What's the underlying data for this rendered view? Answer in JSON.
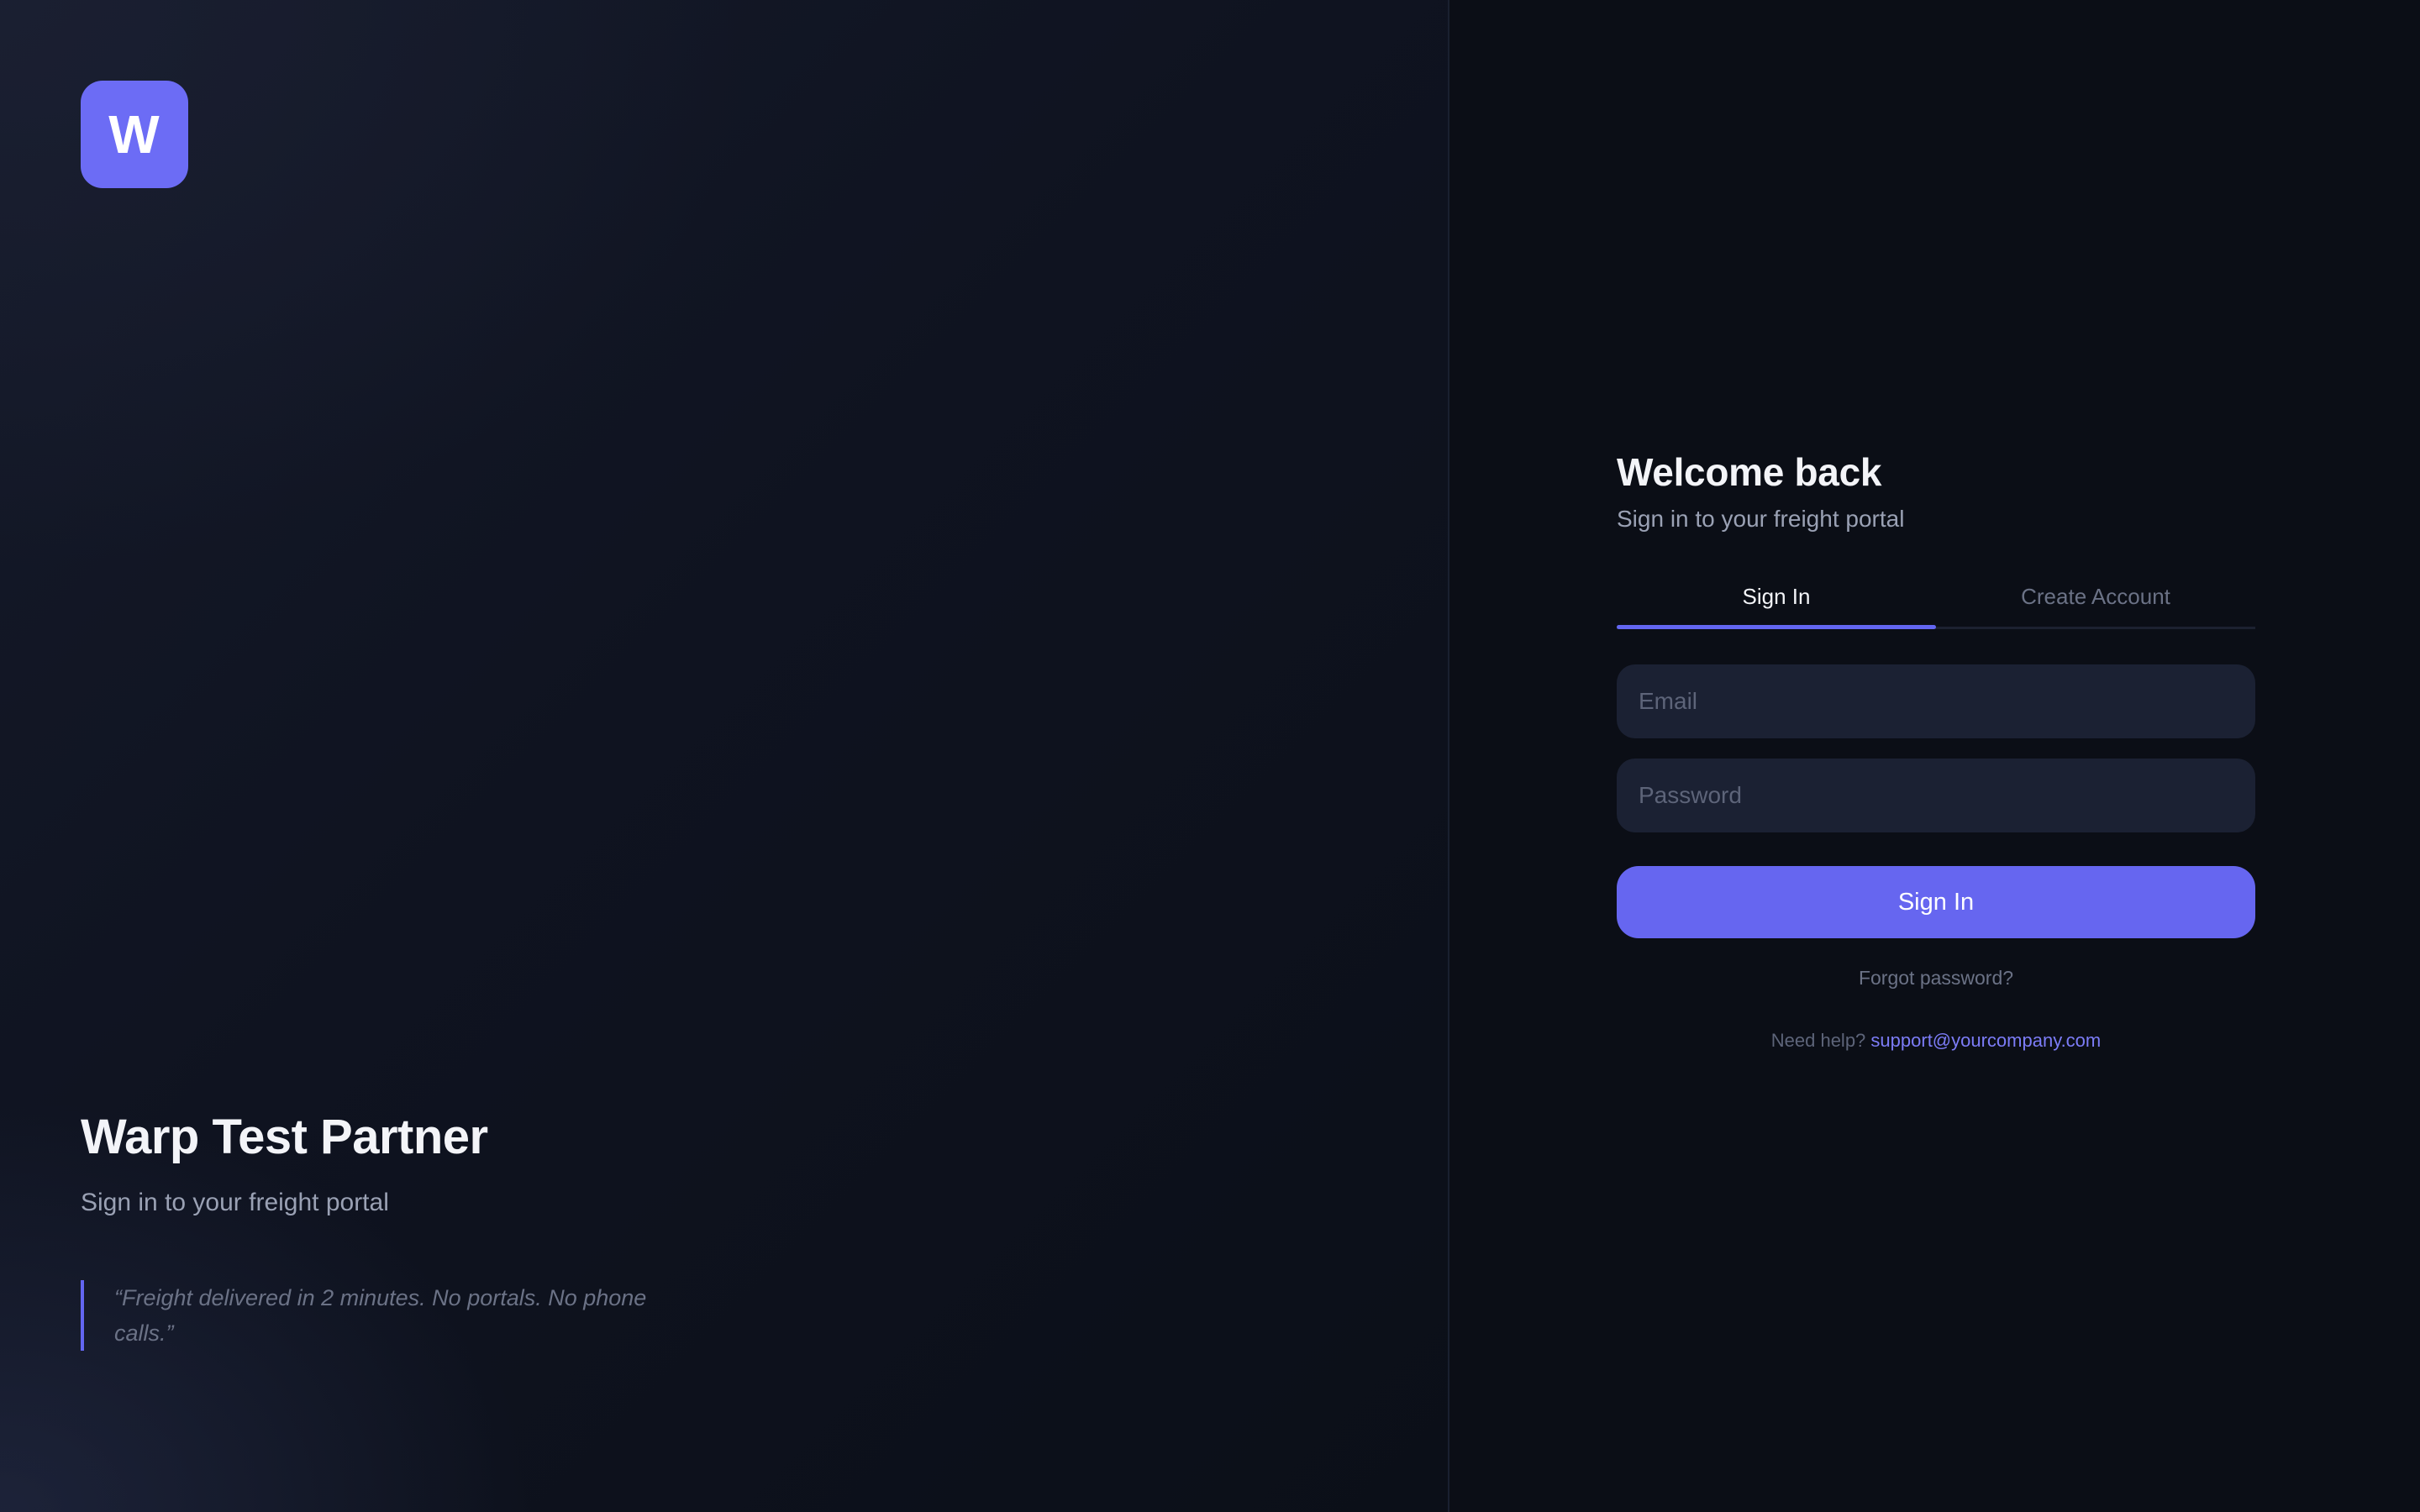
{
  "brand": {
    "logo_letter": "W",
    "title": "Warp Test Partner",
    "subtitle": "Sign in to your freight portal",
    "quote": "“Freight delivered in 2 minutes. No portals. No phone calls.”"
  },
  "auth": {
    "title": "Welcome back",
    "subtitle": "Sign in to your freight portal",
    "tabs": [
      {
        "label": "Sign In",
        "active": true
      },
      {
        "label": "Create Account",
        "active": false
      }
    ],
    "email": {
      "placeholder": "Email",
      "value": ""
    },
    "password": {
      "placeholder": "Password",
      "value": ""
    },
    "submit_label": "Sign In",
    "forgot_label": "Forgot password?",
    "help_prefix": "Need help?",
    "help_email": "support@yourcompany.com"
  },
  "colors": {
    "accent": "#6366f1",
    "background": "#0b0e16",
    "input_background": "#1b2133"
  }
}
